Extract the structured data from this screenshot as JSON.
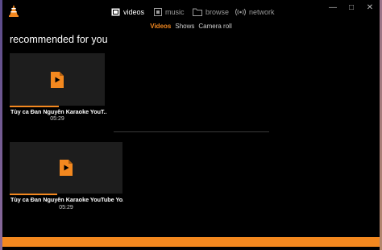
{
  "nav": {
    "items": [
      {
        "label": "videos",
        "icon": "videos-icon",
        "active": true
      },
      {
        "label": "music",
        "icon": "music-icon",
        "active": false
      },
      {
        "label": "browse",
        "icon": "folder-icon",
        "active": false
      },
      {
        "label": "network",
        "icon": "network-icon",
        "active": false
      }
    ]
  },
  "subnav": {
    "items": [
      {
        "label": "Videos",
        "active": true
      },
      {
        "label": "Shows",
        "active": false
      },
      {
        "label": "Camera roll",
        "active": false
      }
    ]
  },
  "main": {
    "section_title": "recommended for you",
    "videos": [
      {
        "title": "Tùy ca Đan Nguyên Karaoke YouT...",
        "duration": "05:29",
        "progress_percent": 52
      },
      {
        "title": "Tùy ca Đan Nguyên Karaoke YouTube Yo...",
        "duration": "05:29",
        "progress_percent": 42
      }
    ]
  },
  "colors": {
    "accent": "#f3881f",
    "background": "#000000",
    "thumbnail": "#1d1d1d"
  }
}
